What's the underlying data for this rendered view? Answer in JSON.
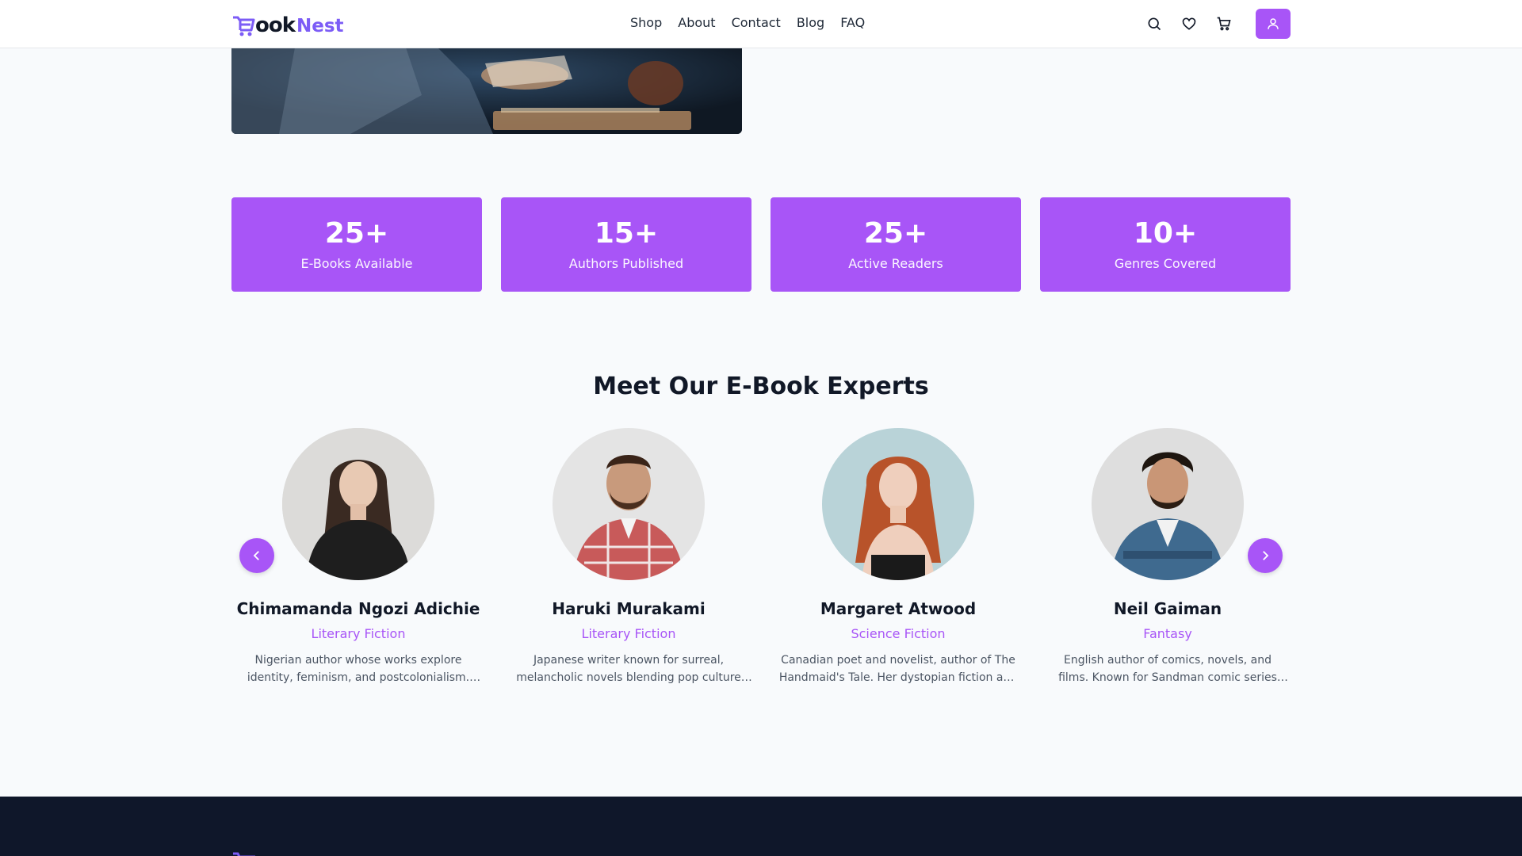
{
  "brand": {
    "logo_b": "B",
    "logo_ook": "ook",
    "logo_nest": "Nest"
  },
  "nav": [
    "Shop",
    "About",
    "Contact",
    "Blog",
    "FAQ"
  ],
  "stats": [
    {
      "value": "25+",
      "label": "E-Books Available"
    },
    {
      "value": "15+",
      "label": "Authors Published"
    },
    {
      "value": "25+",
      "label": "Active Readers"
    },
    {
      "value": "10+",
      "label": "Genres Covered"
    }
  ],
  "experts_section": {
    "title": "Meet Our E-Book Experts",
    "authors": [
      {
        "name": "Chimamanda Ngozi Adichie",
        "genre": "Literary Fiction",
        "bio": "Nigerian author whose works explore identity, feminism, and postcolonialism. Her acclaimed novels include Half of a Yellow Sun."
      },
      {
        "name": "Haruki Murakami",
        "genre": "Literary Fiction",
        "bio": "Japanese writer known for surreal, melancholic novels blending pop culture and magical realism."
      },
      {
        "name": "Margaret Atwood",
        "genre": "Science Fiction",
        "bio": "Canadian poet and novelist, author of The Handmaid's Tale. Her dystopian fiction and essays are celebrated worldwide."
      },
      {
        "name": "Neil Gaiman",
        "genre": "Fantasy",
        "bio": "English author of comics, novels, and films. Known for Sandman comic series and fantasy novels like American Gods."
      }
    ]
  },
  "colors": {
    "accent": "#a855f7",
    "brand": "#7c5cf6",
    "footer_bg": "#0f172a"
  }
}
